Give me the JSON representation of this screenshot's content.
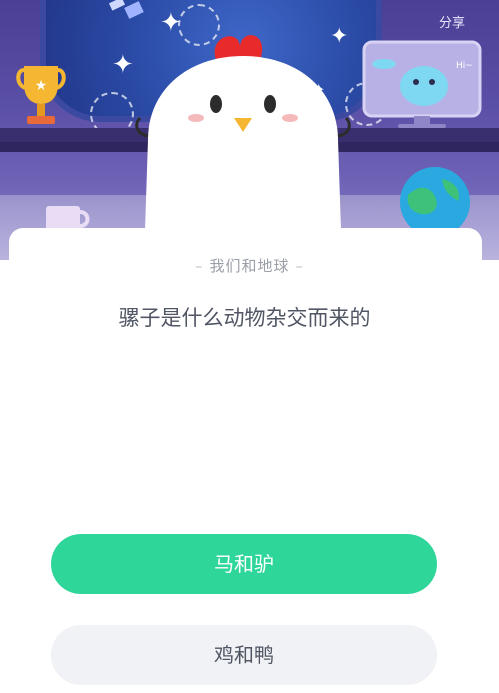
{
  "header": {
    "share_label": "分享"
  },
  "quiz": {
    "category": "我们和地球",
    "question": "骡子是什么动物杂交而来的",
    "options": [
      {
        "label": "马和驴",
        "state": "selected"
      },
      {
        "label": "鸡和鸭",
        "state": "default"
      }
    ]
  },
  "illustration": {
    "monitor_text": "Hi~",
    "icons": [
      "chicken-mascot-icon",
      "trophy-icon",
      "mug-icon",
      "globe-icon",
      "alien-monitor-icon",
      "satellite-icon",
      "star-icon"
    ]
  },
  "colors": {
    "primary": "#2ed69a",
    "option_default": "#f1f2f5",
    "scene_bg": "#4a3f93"
  }
}
